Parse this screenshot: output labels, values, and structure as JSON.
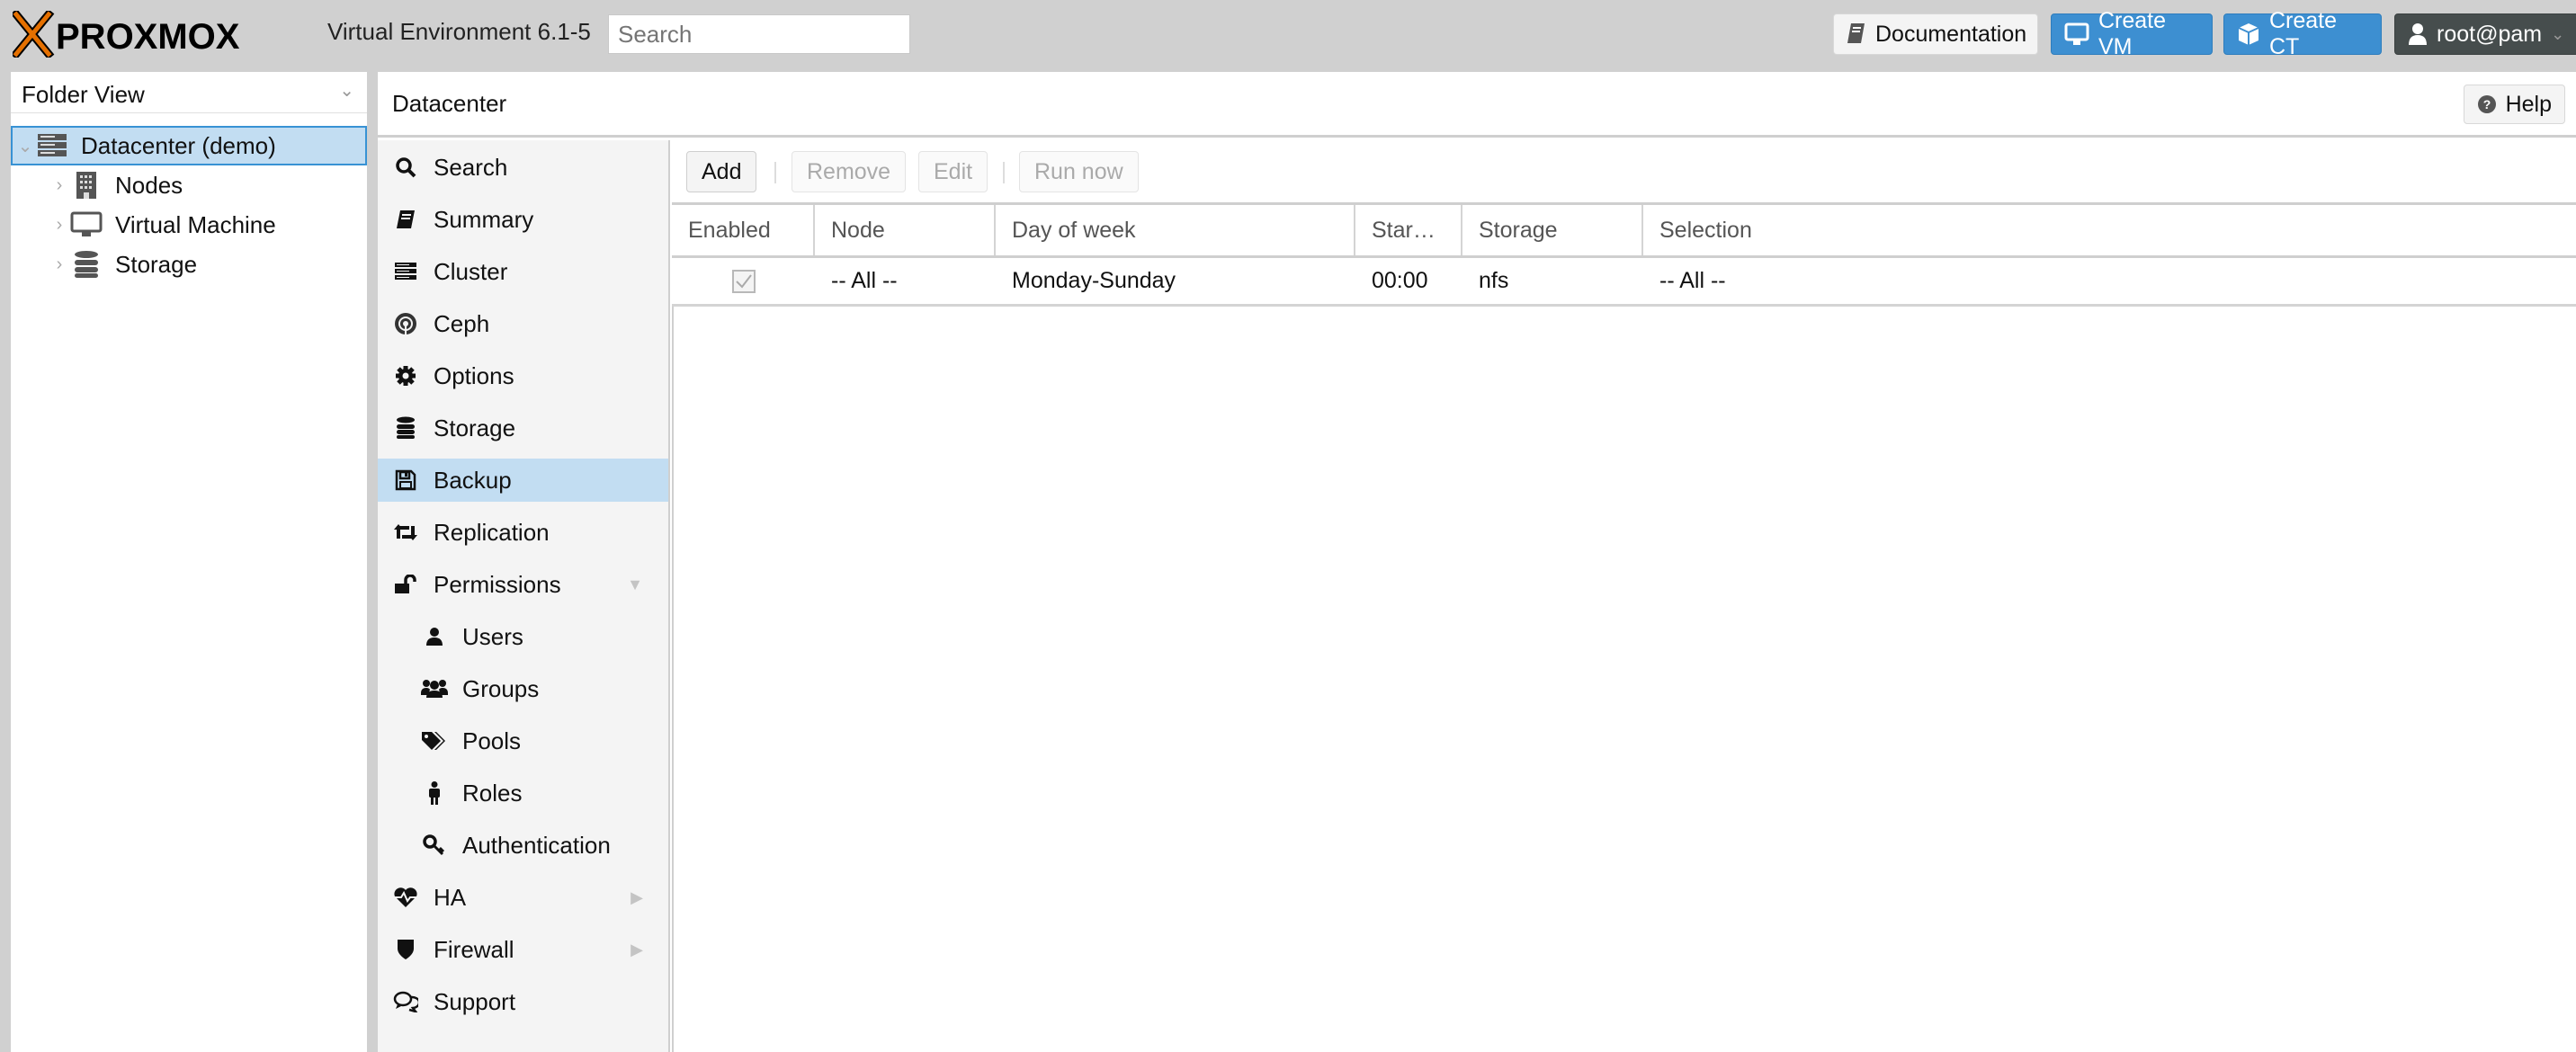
{
  "header": {
    "logo_text": "PROXMOX",
    "version": "Virtual Environment 6.1-5",
    "search_placeholder": "Search",
    "buttons": {
      "documentation": "Documentation",
      "create_vm": "Create VM",
      "create_ct": "Create CT",
      "user": "root@pam"
    },
    "colors": {
      "accent": "#3d8fd1",
      "logo_orange": "#e57000",
      "user_button": "#464d4d"
    }
  },
  "tree": {
    "view_selector": "Folder View",
    "nodes": [
      {
        "label": "Datacenter (demo)",
        "icon": "datacenter-icon",
        "selected": true,
        "expanded": true
      },
      {
        "label": "Nodes",
        "icon": "building-icon"
      },
      {
        "label": "Virtual Machine",
        "icon": "desktop-icon"
      },
      {
        "label": "Storage",
        "icon": "database-icon"
      }
    ]
  },
  "content": {
    "title": "Datacenter",
    "help_label": "Help"
  },
  "nav": {
    "items": [
      {
        "label": "Search",
        "icon": "search-icon"
      },
      {
        "label": "Summary",
        "icon": "book-icon"
      },
      {
        "label": "Cluster",
        "icon": "server-icon"
      },
      {
        "label": "Ceph",
        "icon": "ceph-icon"
      },
      {
        "label": "Options",
        "icon": "gear-icon"
      },
      {
        "label": "Storage",
        "icon": "database-icon"
      },
      {
        "label": "Backup",
        "icon": "floppy-icon",
        "selected": true
      },
      {
        "label": "Replication",
        "icon": "retweet-icon"
      },
      {
        "label": "Permissions",
        "icon": "unlock-icon",
        "expanded": true
      },
      {
        "label": "Users",
        "icon": "user-icon",
        "sub": true
      },
      {
        "label": "Groups",
        "icon": "users-icon",
        "sub": true
      },
      {
        "label": "Pools",
        "icon": "tags-icon",
        "sub": true
      },
      {
        "label": "Roles",
        "icon": "male-icon",
        "sub": true
      },
      {
        "label": "Authentication",
        "icon": "key-icon",
        "sub": true
      },
      {
        "label": "HA",
        "icon": "heartbeat-icon",
        "collapsed": true
      },
      {
        "label": "Firewall",
        "icon": "shield-icon",
        "collapsed": true
      },
      {
        "label": "Support",
        "icon": "comments-icon"
      }
    ]
  },
  "toolbar": {
    "add": "Add",
    "remove": "Remove",
    "edit": "Edit",
    "run_now": "Run now"
  },
  "grid": {
    "columns": [
      "Enabled",
      "Node",
      "Day of week",
      "Star…",
      "Storage",
      "Selection"
    ],
    "rows": [
      {
        "enabled": true,
        "node": "-- All --",
        "day_of_week": "Monday-Sunday",
        "start": "00:00",
        "storage": "nfs",
        "selection": "-- All --"
      }
    ]
  }
}
